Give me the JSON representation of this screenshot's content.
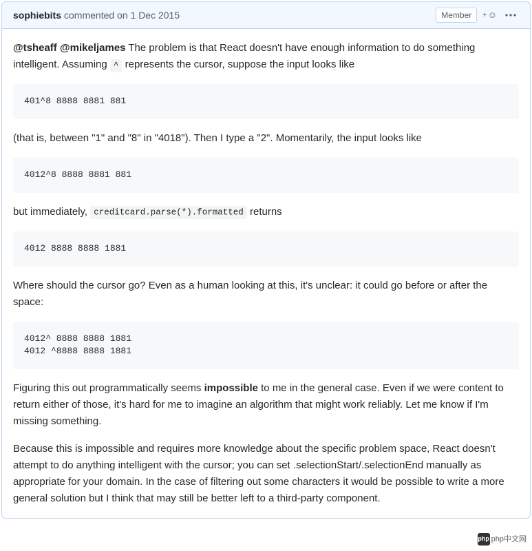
{
  "header": {
    "author": "sophiebits",
    "action": "commented on 1 Dec 2015",
    "badge": "Member"
  },
  "body": {
    "para1": {
      "mention1": "@tsheaff",
      "mention2": "@mikeljames",
      "text1": " The problem is that React doesn't have enough information to do something intelligent. Assuming ",
      "code1": "^",
      "text2": " represents the cursor, suppose the input looks like"
    },
    "codeblock1": "401^8 8888 8881 881",
    "para2": "(that is, between \"1\" and \"8\" in \"4018\"). Then I type a \"2\". Momentarily, the input looks like",
    "codeblock2": "4012^8 8888 8881 881",
    "para3": {
      "text1": "but immediately, ",
      "code1": "creditcard.parse(*).formatted",
      "text2": " returns"
    },
    "codeblock3": "4012 8888 8888 1881",
    "para4": "Where should the cursor go? Even as a human looking at this, it's unclear: it could go before or after the space:",
    "codeblock4": "4012^ 8888 8888 1881\n4012 ^8888 8888 1881",
    "para5": {
      "text1": "Figuring this out programmatically seems ",
      "strong1": "impossible",
      "text2": " to me in the general case. Even if we were content to return either of those, it's hard for me to imagine an algorithm that might work reliably. Let me know if I'm missing something."
    },
    "para6": "Because this is impossible and requires more knowledge about the specific problem space, React doesn't attempt to do anything intelligent with the cursor; you can set .selectionStart/.selectionEnd manually as appropriate for your domain. In the case of filtering out some characters it would be possible to write a more general solution but I think that may still be better left to a third-party component."
  },
  "watermark": {
    "logo": "php",
    "text": "php中文网"
  }
}
